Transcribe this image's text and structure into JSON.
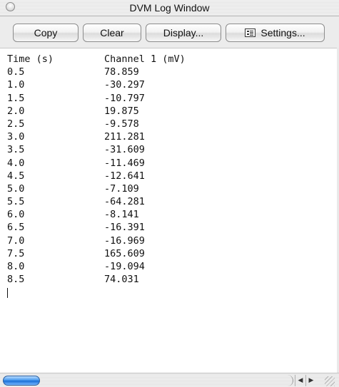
{
  "window": {
    "title": "DVM Log Window"
  },
  "toolbar": {
    "copy_label": "Copy",
    "clear_label": "Clear",
    "display_label": "Display...",
    "settings_label": "Settings..."
  },
  "log": {
    "header": {
      "time": "Time (s)",
      "channel": "Channel 1 (mV)"
    },
    "rows": [
      {
        "time": "0.5",
        "value": "78.859"
      },
      {
        "time": "1.0",
        "value": "-30.297"
      },
      {
        "time": "1.5",
        "value": "-10.797"
      },
      {
        "time": "2.0",
        "value": "19.875"
      },
      {
        "time": "2.5",
        "value": "-9.578"
      },
      {
        "time": "3.0",
        "value": "211.281"
      },
      {
        "time": "3.5",
        "value": "-31.609"
      },
      {
        "time": "4.0",
        "value": "-11.469"
      },
      {
        "time": "4.5",
        "value": "-12.641"
      },
      {
        "time": "5.0",
        "value": "-7.109"
      },
      {
        "time": "5.5",
        "value": "-64.281"
      },
      {
        "time": "6.0",
        "value": "-8.141"
      },
      {
        "time": "6.5",
        "value": "-16.391"
      },
      {
        "time": "7.0",
        "value": "-16.969"
      },
      {
        "time": "7.5",
        "value": "165.609"
      },
      {
        "time": "8.0",
        "value": "-19.094"
      },
      {
        "time": "8.5",
        "value": "74.031"
      }
    ]
  },
  "scrollbar": {
    "position": 0,
    "left_arrow_icon": "◀",
    "right_arrow_icon": "▶"
  },
  "colors": {
    "thumb": "#4a9bf0",
    "window_bg": "#ffffff"
  }
}
